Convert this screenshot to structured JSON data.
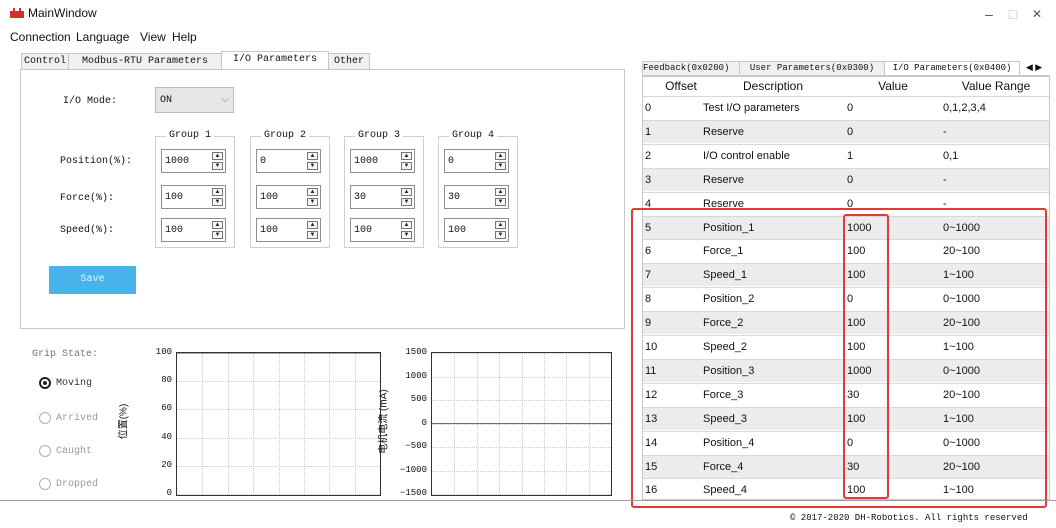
{
  "window": {
    "title": "MainWindow",
    "minimize": "–",
    "maximize": "□",
    "close": "✕"
  },
  "menu": [
    "Connection",
    "Language",
    "View",
    "Help"
  ],
  "left_tabs": [
    "Control",
    "Modbus-RTU Parameters",
    "I/O Parameters",
    "Other"
  ],
  "io": {
    "mode_label": "I/O Mode:",
    "mode_value": "ON",
    "groups": [
      "Group 1",
      "Group 2",
      "Group 3",
      "Group 4"
    ],
    "row_labels": [
      "Position(%):",
      "Force(%):",
      "Speed(%):"
    ],
    "values": [
      [
        "1000",
        "0",
        "1000",
        "0"
      ],
      [
        "100",
        "100",
        "30",
        "30"
      ],
      [
        "100",
        "100",
        "100",
        "100"
      ]
    ],
    "save_label": "Save"
  },
  "grip": {
    "title": "Grip State:",
    "options": [
      "Moving",
      "Arrived",
      "Caught",
      "Dropped"
    ],
    "selected": "Moving"
  },
  "chart_data": [
    {
      "type": "line",
      "ylabel": "位置(%)",
      "ylim": [
        0,
        100
      ],
      "yticks": [
        "100",
        "80",
        "60",
        "40",
        "20",
        "0"
      ],
      "series": [
        {
          "values": [
            100,
            100
          ]
        }
      ],
      "color": "#e53935",
      "grid": true
    },
    {
      "type": "line",
      "ylabel": "电机电流 (mA)",
      "ylim": [
        -1500,
        1500
      ],
      "yticks": [
        "1500",
        "1000",
        "500",
        "0",
        "−500",
        "−1000",
        "−1500"
      ],
      "series": [
        {
          "values": [
            0,
            0
          ]
        }
      ],
      "color": "#e53935",
      "grid": true
    }
  ],
  "right_tabs": [
    "Feedback(0x0200)",
    "User Parameters(0x0300)",
    "I/O Parameters(0x0400)"
  ],
  "right_nav": "◀ ▶",
  "table": {
    "headers": [
      "Offset",
      "Description",
      "Value",
      "Value Range"
    ],
    "rows": [
      [
        "0",
        "Test I/O parameters",
        "0",
        "0,1,2,3,4"
      ],
      [
        "1",
        "Reserve",
        "0",
        "-"
      ],
      [
        "2",
        "I/O control enable",
        "1",
        "0,1"
      ],
      [
        "3",
        "Reserve",
        "0",
        "-"
      ],
      [
        "4",
        "Reserve",
        "0",
        "-"
      ],
      [
        "5",
        "Position_1",
        "1000",
        "0~1000"
      ],
      [
        "6",
        "Force_1",
        "100",
        "20~100"
      ],
      [
        "7",
        "Speed_1",
        "100",
        "1~100"
      ],
      [
        "8",
        "Position_2",
        "0",
        "0~1000"
      ],
      [
        "9",
        "Force_2",
        "100",
        "20~100"
      ],
      [
        "10",
        "Speed_2",
        "100",
        "1~100"
      ],
      [
        "11",
        "Position_3",
        "1000",
        "0~1000"
      ],
      [
        "12",
        "Force_3",
        "30",
        "20~100"
      ],
      [
        "13",
        "Speed_3",
        "100",
        "1~100"
      ],
      [
        "14",
        "Position_4",
        "0",
        "0~1000"
      ],
      [
        "15",
        "Force_4",
        "30",
        "20~100"
      ],
      [
        "16",
        "Speed_4",
        "100",
        "1~100"
      ]
    ]
  },
  "footer": "© 2017-2020 DH-Robotics. All rights reserved",
  "colors": {
    "accent": "#48b4ec",
    "highlight": "#e53935"
  }
}
